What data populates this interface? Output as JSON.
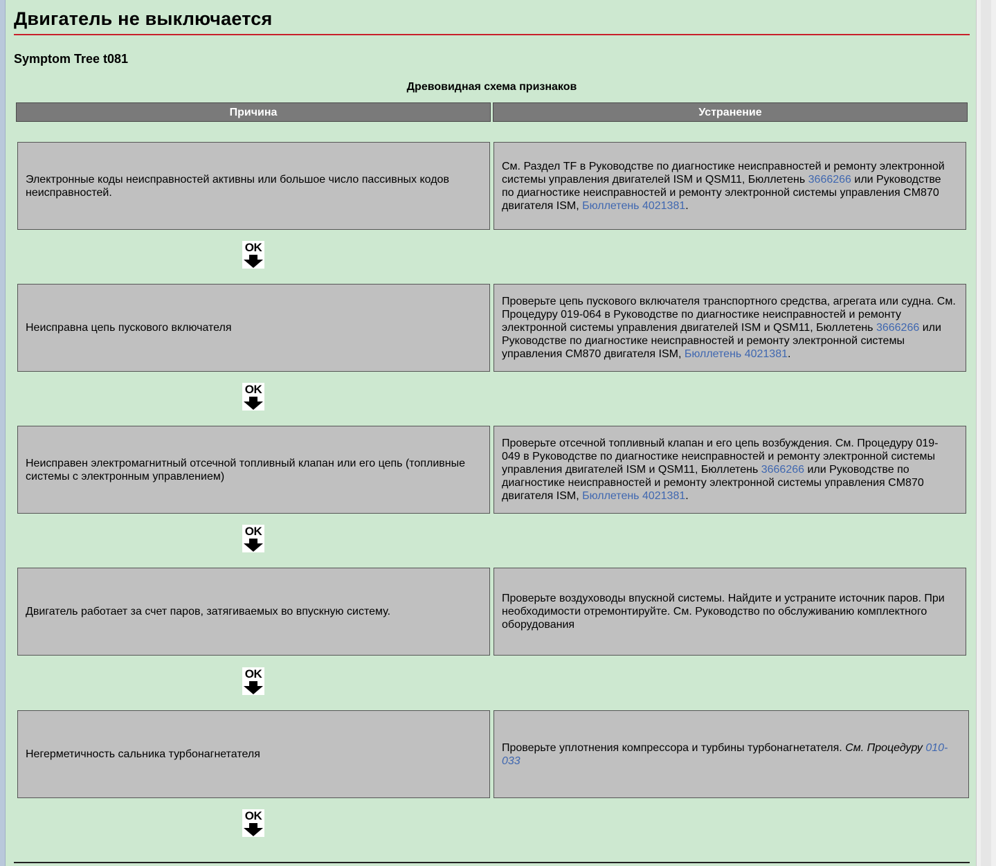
{
  "page": {
    "title": "Двигатель не выключается",
    "subtitle": "Symptom Tree  t081",
    "tree_heading": "Древовидная схема признаков"
  },
  "table": {
    "headers": {
      "cause": "Причина",
      "fix": "Устранение"
    },
    "rows": [
      {
        "cause": "Электронные коды неисправностей активны или большое число пассивных кодов неисправностей.",
        "fix": {
          "t1": "См. Раздел TF в Руководстве по диагностике неисправностей и ремонту электронной системы управления двигателей ISM и QSM11, Бюллетень ",
          "link1": "3666266",
          "t2": " или Руководстве по диагностике неисправностей и ремонту электронной системы управления CM870 двигателя ISM, ",
          "link2": "Бюллетень 4021381",
          "t3": "."
        }
      },
      {
        "cause": "Неисправна цепь пускового включателя",
        "fix": {
          "t1": "Проверьте цепь пускового включателя транспортного средства, агрегата или судна. См. Процедуру 019-064 в Руководстве по диагностике неисправностей и ремонту электронной системы управления двигателей ISM и QSM11, Бюллетень ",
          "link1": "3666266",
          "t2": " или Руководстве по диагностике неисправностей и ремонту электронной системы управления CM870 двигателя ISM, ",
          "link2": "Бюллетень 4021381",
          "t3": "."
        }
      },
      {
        "cause": "Неисправен электромагнитный отсечной топливный клапан или его цепь (топливные системы с электронным управлением)",
        "fix": {
          "t1": "Проверьте отсечной топливный клапан и его цепь возбуждения. См. Процедуру 019-049 в Руководстве по диагностике неисправностей и ремонту электронной системы управления двигателей ISM и QSM11, Бюллетень ",
          "link1": "3666266",
          "t2": " или Руководстве по диагностике неисправностей и ремонту электронной системы управления CM870 двигателя ISM, ",
          "link2": "Бюллетень 4021381",
          "t3": "."
        }
      },
      {
        "cause": "Двигатель работает за счет паров, затягиваемых во впускную систему.",
        "fix": {
          "t1": "Проверьте воздуховоды впускной системы. Найдите и устраните источник паров. При необходимости отремонтируйте. См. Руководство по обслуживанию комплектного оборудования"
        }
      },
      {
        "cause": "Негерметичность сальника турбонагнетателя",
        "fix": {
          "t1": "Проверьте уплотнения компрессора и турбины турбонагнетателя. ",
          "italic": "См. Процедуру ",
          "link1": "010-033"
        }
      }
    ],
    "ok_label": "OK"
  },
  "colors": {
    "link": "#3f67b0",
    "title_rule": "#c8202a",
    "background": "#cde8d0",
    "cell": "#c0c0c0",
    "header": "#7a7a7a"
  },
  "icons": {
    "ok_step": "ok-down-arrow-icon"
  }
}
